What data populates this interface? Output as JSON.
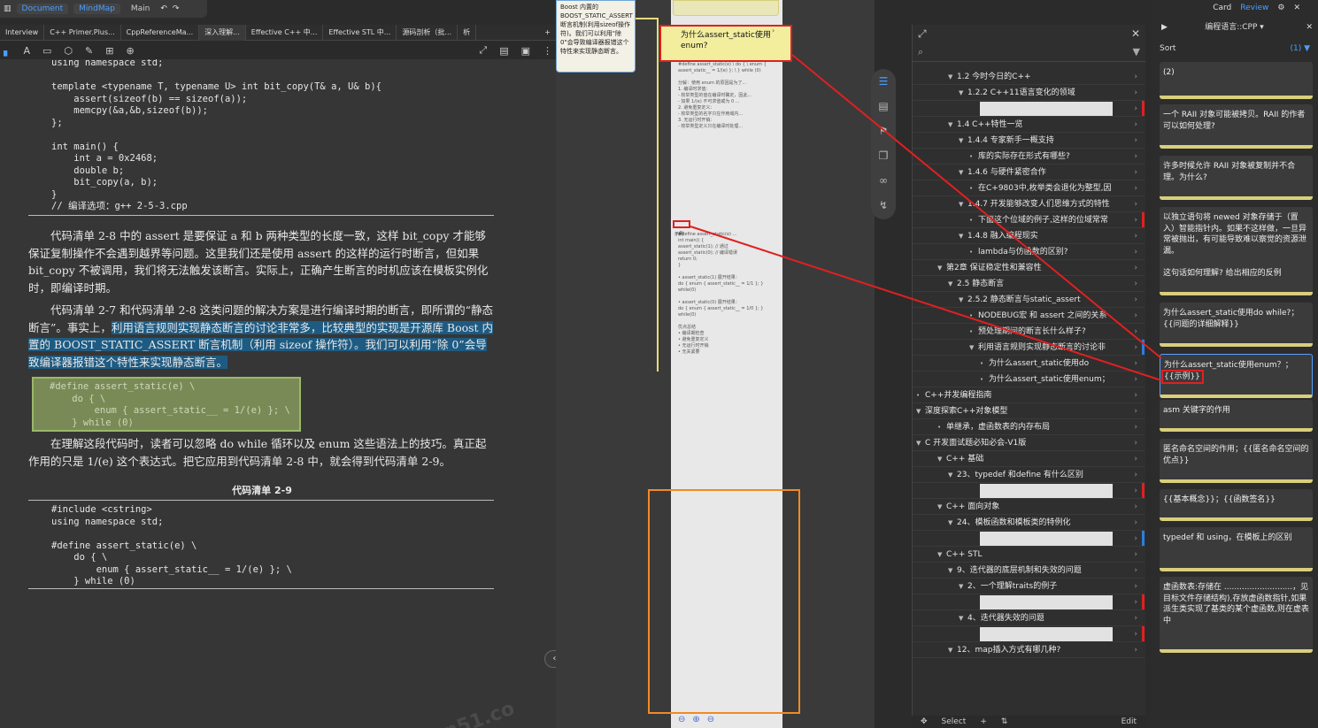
{
  "topbar": {
    "icon": "library-icon",
    "document": "Document",
    "mindmap": "MindMap",
    "main": "Main"
  },
  "tabs": [
    "Interview",
    "C++ Primer.Plus...",
    "CppReferenceMa...",
    "深入理解...",
    "Effective C++ 中...",
    "Effective STL 中...",
    "源码剖析（批...",
    "析"
  ],
  "doc": {
    "code1": "using namespace std;\n\ntemplate <typename T, typename U> int bit_copy(T& a, U& b){\n    assert(sizeof(b) == sizeof(a));\n    memcpy(&a,&b,sizeof(b));\n};\n\nint main() {\n    int a = 0x2468;\n    double b;\n    bit_copy(a, b);\n}\n// 编译选项：g++ 2-5-3.cpp",
    "p1": "代码清单 2-8 中的 assert 是要保证 a 和 b 两种类型的长度一致，这样 bit_copy 才能够保证复制操作不会遇到越界等问题。这里我们还是使用 assert 的这样的运行时断言，但如果 bit_copy 不被调用，我们将无法触发该断言。实际上，正确产生断言的时机应该在模板实例化时，即编译时期。",
    "p2a": "代码清单 2-7 和代码清单 2-8 这类问题的解决方案是进行编译时期的断言，即所谓的“静态断言”。事实上，",
    "p2b": "利用语言规则实现静态断言的讨论非常多，比较典型的实现是开源库 Boost 内置的 BOOST_STATIC_ASSERT 断言机制（利用 sizeof 操作符）。我们可以利用“除 0”会导致编译器报错这个特性来实现静态断言。",
    "code2": "#define assert_static(e) \\\n    do { \\\n        enum { assert_static__ = 1/(e) }; \\\n    } while (0)",
    "p3": "在理解这段代码时，读者可以忽略 do while 循环以及 enum 这些语法上的技巧。真正起作用的只是 1/(e) 这个表达式。把它应用到代码清单 2-8 中，就会得到代码清单 2-9。",
    "caption": "代码清单 2-9",
    "code3": "#include <cstring>\nusing namespace std;\n\n#define assert_static(e) \\\n    do { \\\n        enum { assert_static__ = 1/(e) }; \\\n    } while (0)",
    "watermark": "n51.co"
  },
  "mid": {
    "card_top": "Boost 内置的 BOOST_STATIC_ASSERT 断言机制(利用sizeof操作符)。我们可以利用\"除0\"会导致编译器报错这个特性来实现静态断言。",
    "card_title": "为什么assert_static使用enum?",
    "strip_small": "示例",
    "nav": "‹ ›"
  },
  "outline": {
    "rows": [
      {
        "t": "1.2 今时今日的C++",
        "lvl": 3,
        "tw": "▼"
      },
      {
        "t": "1.2.2 C++11语言变化的领域",
        "lvl": 4,
        "tw": "▼"
      },
      {
        "t": "",
        "lvl": 5,
        "tw": "",
        "thumb": true
      },
      {
        "t": "1.4 C++特性一览",
        "lvl": 3,
        "tw": "▼"
      },
      {
        "t": "1.4.4 专家新手一概支持",
        "lvl": 4,
        "tw": "▼"
      },
      {
        "t": "库的实际存在形式有哪些?",
        "lvl": 5,
        "tw": "•"
      },
      {
        "t": "1.4.6 与硬件紧密合作",
        "lvl": 4,
        "tw": "▼"
      },
      {
        "t": "在C+9803中,枚举类会退化为整型,因",
        "lvl": 5,
        "tw": "•"
      },
      {
        "t": "1.4.7 开发能够改变人们思维方式的特性",
        "lvl": 4,
        "tw": "▼"
      },
      {
        "t": "下面这个位域的例子,这样的位域常常",
        "lvl": 5,
        "tw": "•"
      },
      {
        "t": "1.4.8 融入编程现实",
        "lvl": 4,
        "tw": "▼"
      },
      {
        "t": "lambda与仿函数的区别?",
        "lvl": 5,
        "tw": "•"
      },
      {
        "t": "第2章 保证稳定性和兼容性",
        "lvl": 2,
        "tw": "▼"
      },
      {
        "t": "2.5 静态断言",
        "lvl": 3,
        "tw": "▼"
      },
      {
        "t": "2.5.2 静态断言与static_assert",
        "lvl": 4,
        "tw": "▼"
      },
      {
        "t": "NODEBUG宏 和 assert 之间的关系",
        "lvl": 5,
        "tw": "•"
      },
      {
        "t": "预处理期间的断言长什么样子?",
        "lvl": 5,
        "tw": "•"
      },
      {
        "t": "利用语言规则实现静态断言的讨论非",
        "lvl": 5,
        "tw": "▼"
      },
      {
        "t": "为什么assert_static使用do",
        "lvl": 6,
        "tw": "•"
      },
      {
        "t": "为什么assert_static使用enum；",
        "lvl": 6,
        "tw": "•"
      },
      {
        "t": "C++并发编程指南",
        "lvl": 0,
        "tw": "•"
      },
      {
        "t": "深度探索C++对象模型",
        "lvl": 0,
        "tw": "▼"
      },
      {
        "t": "单继承，虚函数表的内存布局",
        "lvl": 2,
        "tw": "•"
      },
      {
        "t": "C 开发面试题必知必会-V1版",
        "lvl": 0,
        "tw": "▼"
      },
      {
        "t": "C++ 基础",
        "lvl": 2,
        "tw": "▼"
      },
      {
        "t": "23、typedef 和define 有什么区别",
        "lvl": 3,
        "tw": "▼"
      },
      {
        "t": "",
        "lvl": 5,
        "tw": "",
        "thumb": true
      },
      {
        "t": "C++ 面向对象",
        "lvl": 2,
        "tw": "▼"
      },
      {
        "t": "24、模板函数和模板类的特例化",
        "lvl": 3,
        "tw": "▼"
      },
      {
        "t": "",
        "lvl": 5,
        "tw": "",
        "thumb": true
      },
      {
        "t": "C++ STL",
        "lvl": 2,
        "tw": "▼"
      },
      {
        "t": "9、迭代器的底层机制和失效的问题",
        "lvl": 3,
        "tw": "▼"
      },
      {
        "t": "2、一个理解traits的例子",
        "lvl": 4,
        "tw": "▼"
      },
      {
        "t": "",
        "lvl": 5,
        "tw": "",
        "thumb": true
      },
      {
        "t": "4、迭代器失效的问题",
        "lvl": 4,
        "tw": "▼"
      },
      {
        "t": "",
        "lvl": 5,
        "tw": "",
        "thumb": true
      },
      {
        "t": "12、map插入方式有哪几种?",
        "lvl": 3,
        "tw": "▼"
      }
    ],
    "footer": {
      "select": "Select",
      "edit": "Edit"
    }
  },
  "right": {
    "top": [
      "Card",
      "Review"
    ],
    "title": "编程语言::CPP ▾",
    "sort": "Sort",
    "cards": [
      {
        "t": "(2)"
      },
      {
        "t": "一个 RAII 对象可能被拷贝。RAII 的作者可以如何处理?"
      },
      {
        "t": "许多时候允许 RAII 对象被复制并不合理。为什么?"
      },
      {
        "t": "以独立语句将 newed 对象存储于（置入）智能指针内。如果不这样做，一旦异常被抛出，有可能导致难以察觉的资源泄漏。\n\n这句话如何理解? 给出相应的反例"
      },
      {
        "t": "为什么assert_static使用do while?；{{问题的详细解释}}"
      },
      {
        "t": "为什么assert_static使用enum？；{{示例}}"
      },
      {
        "t": "asm 关键字的作用"
      },
      {
        "t": "匿名命名空间的作用；{{匿名命名空间的优点}}"
      },
      {
        "t": "{{基本概念}}；{{函数签名}}"
      },
      {
        "t": "typedef 和 using，在模板上的区别"
      },
      {
        "t": "虚函数表:存储在 ...........................，见目标文件存储结构),存放虚函数指针,如果派生类实现了基类的某个虚函数,则在虚表中"
      }
    ]
  },
  "colors": {
    "highlight": "#1e5b82",
    "red": "#e02020",
    "orange": "#f08a24",
    "accent_blue": "#4a9eff"
  }
}
